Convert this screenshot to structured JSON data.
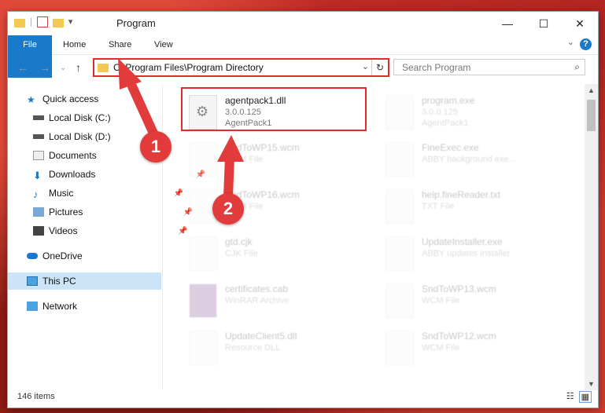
{
  "window": {
    "title": "Program",
    "controls": {
      "minimize": "—",
      "maximize": "☐",
      "close": "✕"
    }
  },
  "ribbon": {
    "tabs": [
      "File",
      "Home",
      "Share",
      "View"
    ],
    "help": "?"
  },
  "address": {
    "path": "C:\\Program Files\\Program Directory",
    "search_placeholder": "Search Program"
  },
  "sidebar": [
    {
      "label": "Quick access"
    },
    {
      "label": "Local Disk (C:)"
    },
    {
      "label": "Local Disk (D:)"
    },
    {
      "label": "Documents"
    },
    {
      "label": "Downloads"
    },
    {
      "label": "Music"
    },
    {
      "label": "Pictures"
    },
    {
      "label": "Videos"
    },
    {
      "label": "OneDrive"
    },
    {
      "label": "This PC"
    },
    {
      "label": "Network"
    }
  ],
  "files": [
    {
      "name": "agentpack1.dll",
      "line1": "3.0.0.125",
      "line2": "AgentPack1"
    },
    {
      "name": "program.exe",
      "line1": "3.0.0.125",
      "line2": "AgentPack1"
    },
    {
      "name": "SndToWP15.wcm",
      "line1": "WCM File",
      "line2": ""
    },
    {
      "name": "FineExec.exe",
      "line1": "ABBY background exe...",
      "line2": ""
    },
    {
      "name": "SndToWP16.wcm",
      "line1": "WCM File",
      "line2": ""
    },
    {
      "name": "help.fineReader.txt",
      "line1": "TXT File",
      "line2": ""
    },
    {
      "name": "gtd.cjk",
      "line1": "CJK File",
      "line2": ""
    },
    {
      "name": "UpdateInstaller.exe",
      "line1": "ABBY updates installer",
      "line2": ""
    },
    {
      "name": "certificates.cab",
      "line1": "WinRAR Archive",
      "line2": ""
    },
    {
      "name": "SndToWP13.wcm",
      "line1": "WCM File",
      "line2": ""
    },
    {
      "name": "UpdateClient5.dll",
      "line1": "Resource DLL",
      "line2": ""
    },
    {
      "name": "SndToWP12.wcm",
      "line1": "WCM File",
      "line2": ""
    }
  ],
  "status": {
    "count": "146 items"
  },
  "callouts": [
    "1",
    "2"
  ],
  "colors": {
    "accent": "#1979ca",
    "highlight": "#e02c2c",
    "callout": "#e23b3b"
  }
}
